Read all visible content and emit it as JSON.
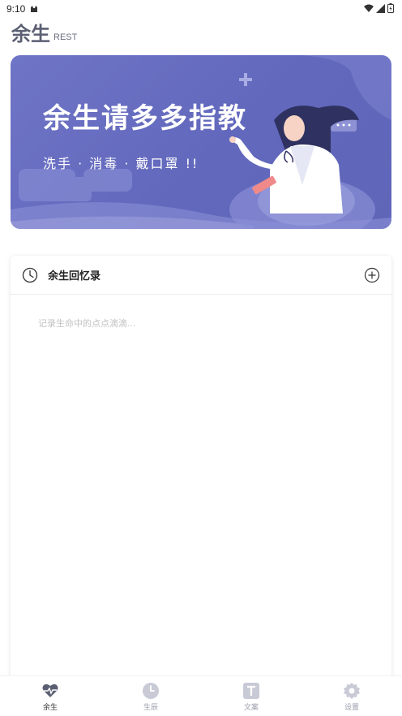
{
  "status_bar": {
    "time": "9:10"
  },
  "header": {
    "title": "余生",
    "subtitle": "REST"
  },
  "banner": {
    "title": "余生请多多指教",
    "subtitle": "洗手 · 消毒 · 戴口罩 !!"
  },
  "card": {
    "title": "余生回忆录",
    "placeholder": "记录生命中的点点滴滴..."
  },
  "nav": {
    "items": [
      {
        "label": "余生",
        "icon": "heart-pulse-icon",
        "active": true
      },
      {
        "label": "生辰",
        "icon": "clock-icon",
        "active": false
      },
      {
        "label": "文案",
        "icon": "text-doc-icon",
        "active": false
      },
      {
        "label": "设置",
        "icon": "gear-icon",
        "active": false
      }
    ]
  },
  "colors": {
    "accent": "#5b5f73",
    "banner": "#6268bc",
    "inactive": "#c8cad6"
  }
}
